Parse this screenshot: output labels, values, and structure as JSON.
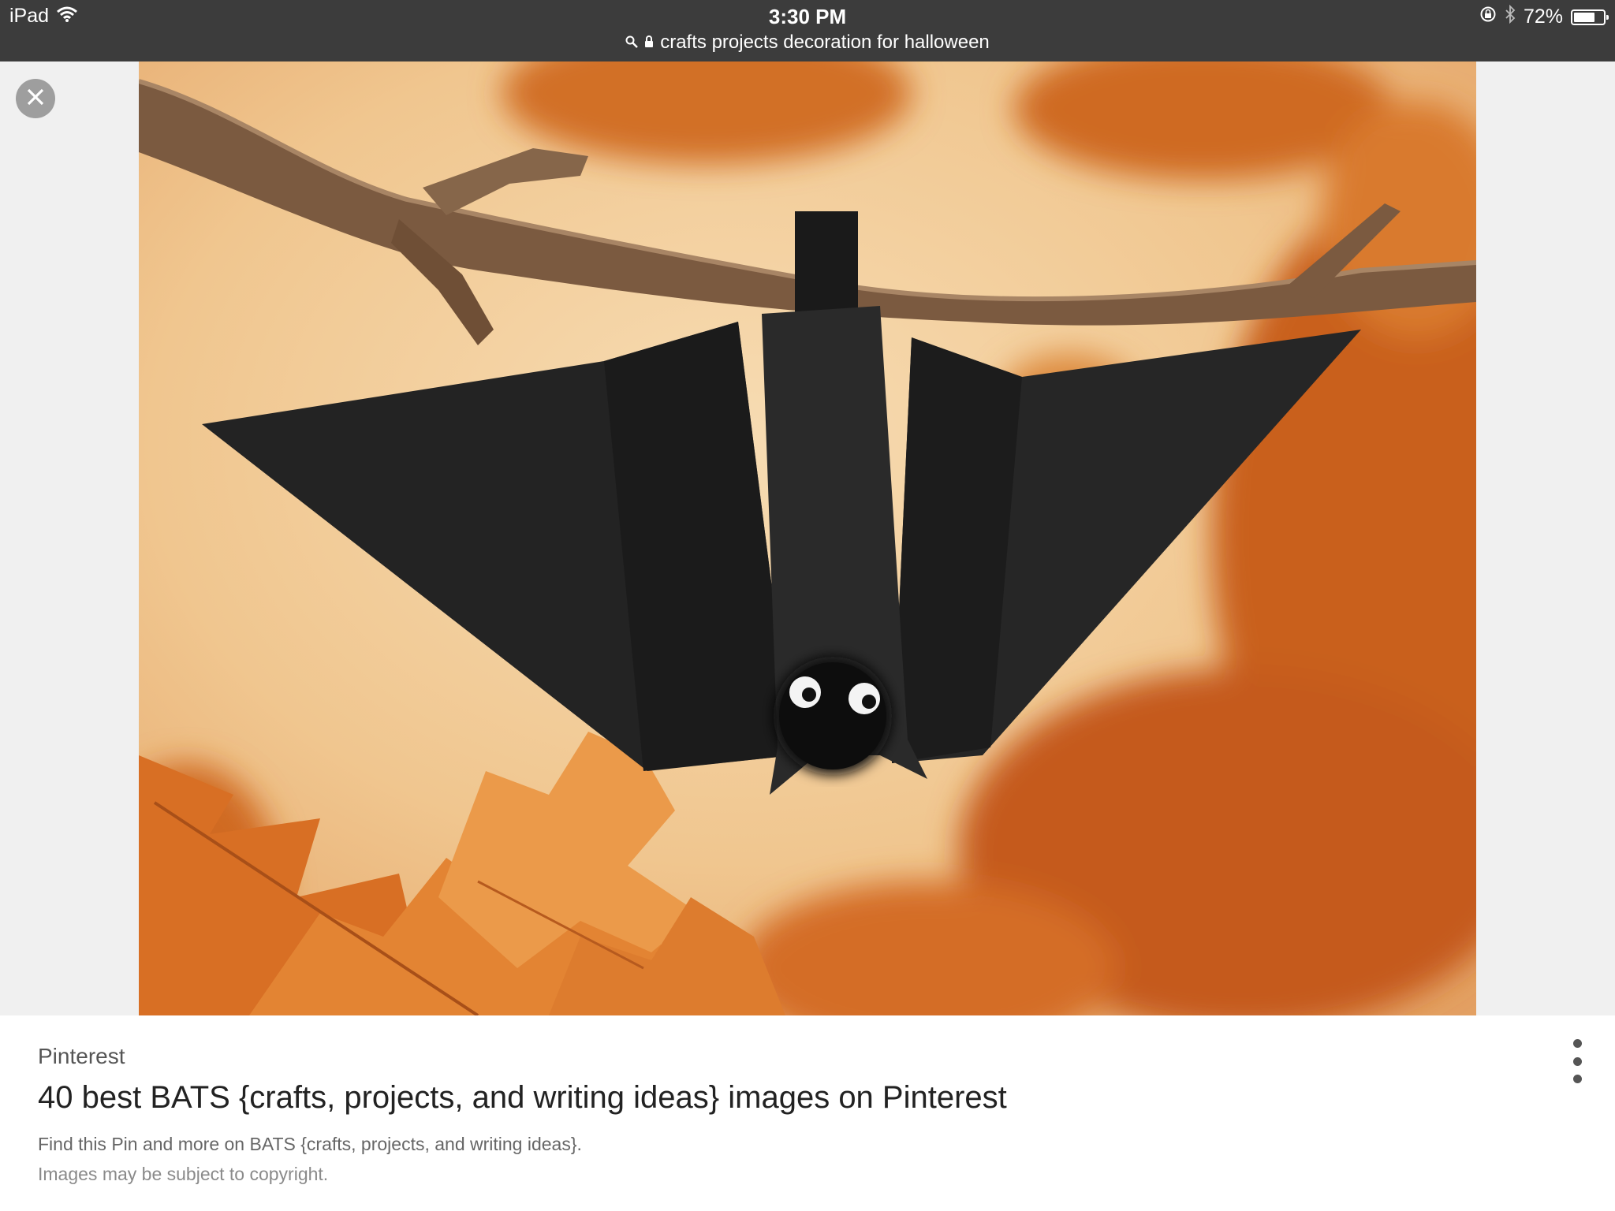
{
  "status_bar": {
    "device": "iPad",
    "time": "3:30 PM",
    "url": "crafts projects decoration for halloween",
    "battery_percent": "72%",
    "battery_level": 0.72,
    "icons": [
      "wifi-icon",
      "search-icon",
      "lock-icon",
      "orientation-lock-icon",
      "bluetooth-icon",
      "battery-icon"
    ]
  },
  "viewer": {
    "close_icon": "close-icon",
    "image_alt": "Black paper bat craft hanging upside down from a branch with orange autumn leaves"
  },
  "result": {
    "source": "Pinterest",
    "title": "40 best BATS {crafts, projects, and writing ideas} images on Pinterest",
    "description": "Find this Pin and more on BATS {crafts, projects, and writing ideas}.",
    "copyright": "Images may be subject to copyright.",
    "menu_icon": "more-vert-icon"
  },
  "colors": {
    "status_bar_bg": "#3c3c3c",
    "page_bg": "#f0f0f0",
    "leaf_orange": "#d9742a",
    "bat_black": "#1c1c1c"
  }
}
